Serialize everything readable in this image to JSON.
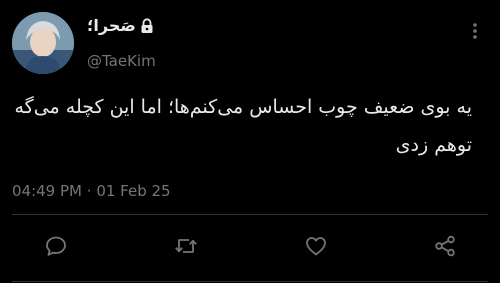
{
  "tweet": {
    "display_name": "صَحرا؛",
    "handle": "@TaeKim",
    "text_line1": "یه بوی ضعیف چوب احساس می‌کنم‌ها؛ اما این کچله می‌گه",
    "text_line2": "توهم زدی",
    "time": "04:49 PM",
    "separator": "·",
    "date": "01 Feb 25"
  },
  "icons": {
    "lock": "lock-icon",
    "more": "more-vertical-icon",
    "reply": "reply-icon",
    "retweet": "retweet-icon",
    "like": "heart-icon",
    "share": "share-icon"
  },
  "colors": {
    "background": "#000000",
    "text": "#e7e9ea",
    "secondary": "#71767b",
    "divider": "#2f3336"
  }
}
